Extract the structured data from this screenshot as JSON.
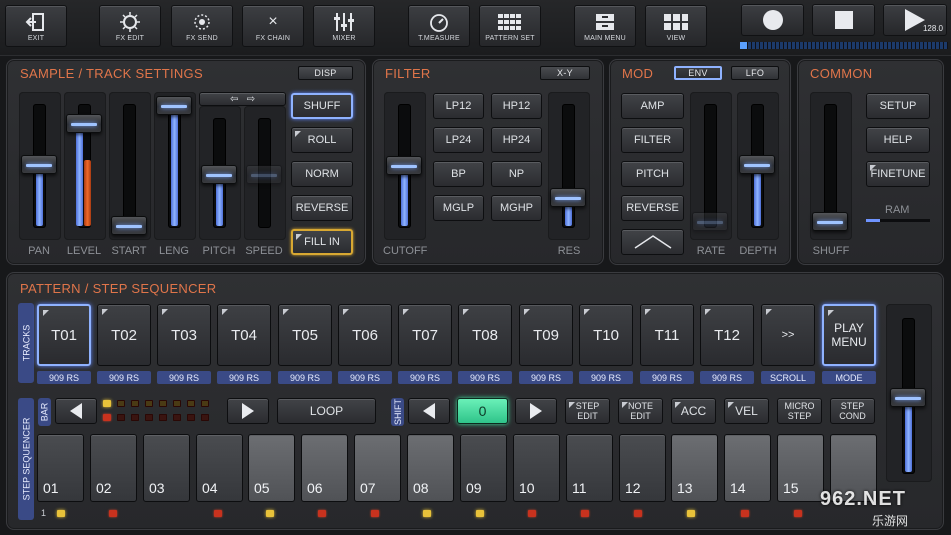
{
  "toolbar": {
    "exit": "EXIT",
    "fx_edit": "FX EDIT",
    "fx_send": "FX SEND",
    "fx_chain": "FX CHAIN",
    "mixer": "MIXER",
    "tmeasure": "T.MEASURE",
    "patternset": "PATTERN SET",
    "main_menu": "MAIN MENU",
    "view": "VIEW",
    "tempo": "128.0",
    "fx_chain_glyph": "×"
  },
  "sample": {
    "title": "SAMPLE / TRACK SETTINGS",
    "disp": "DISP",
    "faders": [
      "PAN",
      "LEVEL",
      "START",
      "LENG",
      "PITCH",
      "SPEED"
    ],
    "buttons": [
      "SHUFF",
      "ROLL",
      "NORM",
      "REVERSE",
      "FILL IN"
    ]
  },
  "filter": {
    "title": "FILTER",
    "xy": "X-Y",
    "buttons": [
      "LP12",
      "HP12",
      "LP24",
      "HP24",
      "BP",
      "NP",
      "MGLP",
      "MGHP"
    ],
    "faders": [
      "CUTOFF",
      "RES"
    ]
  },
  "mod": {
    "title": "MOD",
    "env": "ENV",
    "lfo": "LFO",
    "buttons": [
      "AMP",
      "FILTER",
      "PITCH",
      "REVERSE"
    ],
    "faders": [
      "RATE",
      "DEPTH"
    ]
  },
  "common": {
    "title": "COMMON",
    "shuff": "SHUFF",
    "buttons": [
      "SETUP",
      "HELP",
      "FINETUNE"
    ],
    "ram": "RAM"
  },
  "sequencer": {
    "title": "PATTERN / STEP SEQUENCER",
    "tracks_label": "TRACKS",
    "tracks": [
      "T01",
      "T02",
      "T03",
      "T04",
      "T05",
      "T06",
      "T07",
      "T08",
      "T09",
      "T10",
      "T11",
      "T12"
    ],
    "kits": [
      "909 RS",
      "909 RS",
      "909 RS",
      "909 RS",
      "909 RS",
      "909 RS",
      "909 RS",
      "909 RS",
      "909 RS",
      "909 RS",
      "909 RS",
      "909 RS"
    ],
    "scroll_btn": ">>",
    "scroll": "SCROLL",
    "play_menu": "PLAY MENU",
    "mode": "MODE",
    "bar": "BAR",
    "loop": "LOOP",
    "shift": "SHIFT",
    "shift_value": "0",
    "step_edit": "STEP EDIT",
    "note_edit": "NOTE EDIT",
    "acc": "ACC",
    "vel": "VEL",
    "micro_step": "MICRO STEP",
    "step_cond": "STEP COND",
    "step_seq_label": "STEP SEQUENCER",
    "steps": [
      "01",
      "02",
      "03",
      "04",
      "05",
      "06",
      "07",
      "08",
      "09",
      "10",
      "11",
      "12",
      "13",
      "14",
      "15"
    ],
    "first_step_marker": "1"
  },
  "watermark": {
    "logo": "962.NET",
    "sub": "乐游网"
  },
  "colors": {
    "accent": "#e0754a",
    "select": "#8fb2ff",
    "tag": "#3a4a86",
    "active_green": "#3fe0a0"
  }
}
